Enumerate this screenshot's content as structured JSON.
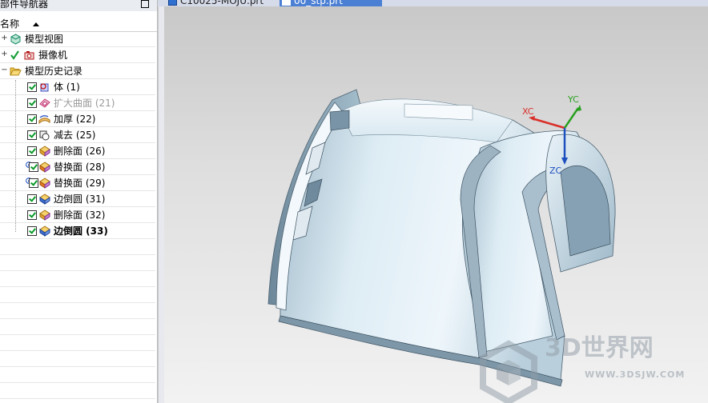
{
  "navigator": {
    "title": "部件导航器",
    "column_header": "名称",
    "nodes": [
      {
        "label": "模型视图",
        "icon": "model-views-icon",
        "expander": "+"
      },
      {
        "label": "摄像机",
        "icon": "camera-icon",
        "expander": "+"
      },
      {
        "label": "模型历史记录",
        "icon": "folder-open-icon",
        "expander": "−"
      }
    ],
    "features": [
      {
        "label": "体 (1)",
        "icon": "body-icon",
        "state": "normal"
      },
      {
        "label": "扩大曲面 (21)",
        "icon": "enlarge-surface-icon",
        "state": "dim"
      },
      {
        "label": "加厚 (22)",
        "icon": "thicken-icon",
        "state": "normal"
      },
      {
        "label": "减去 (25)",
        "icon": "subtract-icon",
        "state": "normal"
      },
      {
        "label": "删除面 (26)",
        "icon": "delete-face-icon",
        "state": "normal"
      },
      {
        "label": "替换面 (28)",
        "icon": "replace-face-icon",
        "state": "normal"
      },
      {
        "label": "替换面 (29)",
        "icon": "replace-face-icon",
        "state": "normal"
      },
      {
        "label": "边倒圆 (31)",
        "icon": "edge-blend-icon",
        "state": "normal"
      },
      {
        "label": "删除面 (32)",
        "icon": "delete-face-icon",
        "state": "normal"
      },
      {
        "label": "边倒圆 (33)",
        "icon": "edge-blend-icon",
        "state": "bold"
      }
    ]
  },
  "tabs": [
    {
      "label": "C10025-MOJU.prt",
      "active": false
    },
    {
      "label": "00_stp.prt",
      "active": true
    }
  ],
  "viewport": {
    "axis_labels": {
      "x": "XC",
      "y": "YC",
      "z": "ZC"
    },
    "watermark": {
      "text": "3D世界网",
      "url": "WWW.3DSJW.COM"
    }
  },
  "colors": {
    "accent": "#4a7fd4",
    "check": "#0a9a2a",
    "axis_x": "#d9302a",
    "axis_y": "#2aa020",
    "axis_z": "#1d4fbf"
  }
}
